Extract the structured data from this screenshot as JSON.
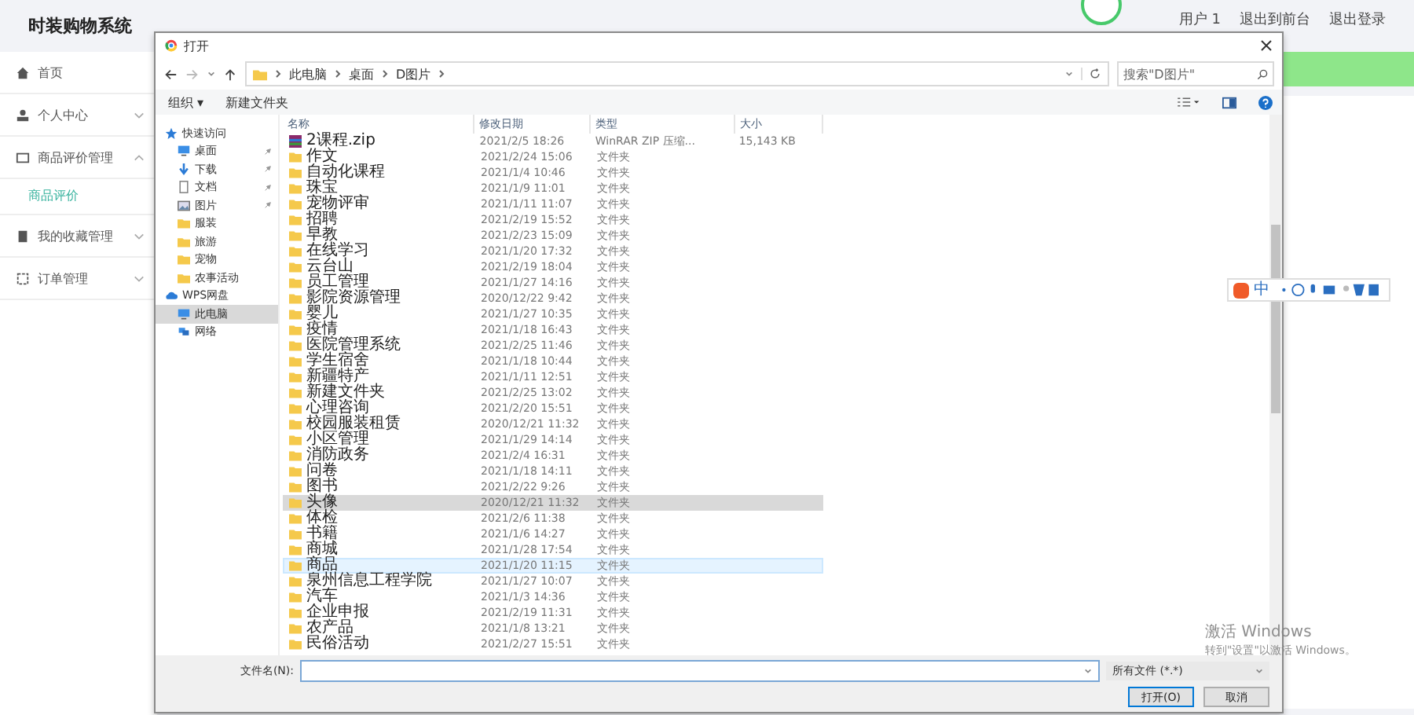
{
  "app": {
    "title": "时装购物系统",
    "user": "用户 1",
    "links": [
      "退出到前台",
      "退出登录"
    ]
  },
  "sidebar": [
    {
      "label": "首页"
    },
    {
      "label": "个人中心",
      "expanded": false
    },
    {
      "label": "商品评价管理",
      "expanded": true,
      "children": [
        {
          "label": "商品评价",
          "selected": true
        }
      ]
    },
    {
      "label": "我的收藏管理",
      "expanded": false
    },
    {
      "label": "订单管理",
      "expanded": false
    }
  ],
  "dialog": {
    "title": "打开",
    "path": [
      "此电脑",
      "桌面",
      "D图片"
    ],
    "search": {
      "placeholder": "搜索\"D图片\""
    },
    "toolbar": [
      "组织 ▾",
      "新建文件夹"
    ],
    "nav": [
      {
        "kind": "star",
        "label": "快速访问",
        "pinned": false,
        "selected": false
      },
      {
        "kind": "desktop",
        "label": "桌面",
        "pinned": true,
        "selected": false
      },
      {
        "kind": "download",
        "label": "下载",
        "pinned": true,
        "selected": false
      },
      {
        "kind": "doc",
        "label": "文档",
        "pinned": true,
        "selected": false
      },
      {
        "kind": "image",
        "label": "图片",
        "pinned": true,
        "selected": false
      },
      {
        "kind": "folder",
        "label": "服装",
        "pinned": false,
        "selected": false
      },
      {
        "kind": "folder",
        "label": "旅游",
        "pinned": false,
        "selected": false
      },
      {
        "kind": "folder",
        "label": "宠物",
        "pinned": false,
        "selected": false
      },
      {
        "kind": "folder",
        "label": "农事活动",
        "pinned": false,
        "selected": false
      },
      {
        "kind": "cloud",
        "label": "WPS网盘",
        "pinned": false,
        "selected": false
      },
      {
        "kind": "pc",
        "label": "此电脑",
        "pinned": false,
        "selected": true
      },
      {
        "kind": "network",
        "label": "网络",
        "pinned": false,
        "selected": false
      }
    ],
    "columns": [
      "名称",
      "修改日期",
      "类型",
      "大小"
    ],
    "files": [
      {
        "kind": "zip",
        "name": "2课程.zip",
        "date": "2021/2/5 18:26",
        "type": "WinRAR ZIP 压缩...",
        "size": "15,143 KB",
        "selected": false,
        "hovered": false
      },
      {
        "kind": "folder",
        "name": "作文",
        "date": "2021/2/24 15:06",
        "type": "文件夹",
        "selected": false,
        "hovered": false
      },
      {
        "kind": "folder",
        "name": "自动化课程",
        "date": "2021/1/4 10:46",
        "type": "文件夹",
        "selected": false,
        "hovered": false
      },
      {
        "kind": "folder",
        "name": "珠宝",
        "date": "2021/1/9 11:01",
        "type": "文件夹",
        "selected": false,
        "hovered": false
      },
      {
        "kind": "folder",
        "name": "宠物评审",
        "date": "2021/1/11 11:07",
        "type": "文件夹",
        "selected": false,
        "hovered": false
      },
      {
        "kind": "folder",
        "name": "招聘",
        "date": "2021/2/19 15:52",
        "type": "文件夹",
        "selected": false,
        "hovered": false
      },
      {
        "kind": "folder",
        "name": "早教",
        "date": "2021/2/23 15:09",
        "type": "文件夹",
        "selected": false,
        "hovered": false
      },
      {
        "kind": "folder",
        "name": "在线学习",
        "date": "2021/1/20 17:32",
        "type": "文件夹",
        "selected": false,
        "hovered": false
      },
      {
        "kind": "folder",
        "name": "云台山",
        "date": "2021/2/19 18:04",
        "type": "文件夹",
        "selected": false,
        "hovered": false
      },
      {
        "kind": "folder",
        "name": "员工管理",
        "date": "2021/1/27 14:16",
        "type": "文件夹",
        "selected": false,
        "hovered": false
      },
      {
        "kind": "folder",
        "name": "影院资源管理",
        "date": "2020/12/22 9:42",
        "type": "文件夹",
        "selected": false,
        "hovered": false
      },
      {
        "kind": "folder",
        "name": "婴儿",
        "date": "2021/1/27 10:35",
        "type": "文件夹",
        "selected": false,
        "hovered": false
      },
      {
        "kind": "folder",
        "name": "疫情",
        "date": "2021/1/18 16:43",
        "type": "文件夹",
        "selected": false,
        "hovered": false
      },
      {
        "kind": "folder",
        "name": "医院管理系统",
        "date": "2021/2/25 11:46",
        "type": "文件夹",
        "selected": false,
        "hovered": false
      },
      {
        "kind": "folder",
        "name": "学生宿舍",
        "date": "2021/1/18 10:44",
        "type": "文件夹",
        "selected": false,
        "hovered": false
      },
      {
        "kind": "folder",
        "name": "新疆特产",
        "date": "2021/1/11 12:51",
        "type": "文件夹",
        "selected": false,
        "hovered": false
      },
      {
        "kind": "folder",
        "name": "新建文件夹",
        "date": "2021/2/25 13:02",
        "type": "文件夹",
        "selected": false,
        "hovered": false
      },
      {
        "kind": "folder",
        "name": "心理咨询",
        "date": "2021/2/20 15:51",
        "type": "文件夹",
        "selected": false,
        "hovered": false
      },
      {
        "kind": "folder",
        "name": "校园服装租赁",
        "date": "2020/12/21 11:32",
        "type": "文件夹",
        "selected": false,
        "hovered": false
      },
      {
        "kind": "folder",
        "name": "小区管理",
        "date": "2021/1/29 14:14",
        "type": "文件夹",
        "selected": false,
        "hovered": false
      },
      {
        "kind": "folder",
        "name": "消防政务",
        "date": "2021/2/4 16:31",
        "type": "文件夹",
        "selected": false,
        "hovered": false
      },
      {
        "kind": "folder",
        "name": "问卷",
        "date": "2021/1/18 14:11",
        "type": "文件夹",
        "selected": false,
        "hovered": false
      },
      {
        "kind": "folder",
        "name": "图书",
        "date": "2021/2/22 9:26",
        "type": "文件夹",
        "selected": false,
        "hovered": false
      },
      {
        "kind": "folder",
        "name": "头像",
        "date": "2020/12/21 11:32",
        "type": "文件夹",
        "selected": true,
        "hovered": false
      },
      {
        "kind": "folder",
        "name": "体检",
        "date": "2021/2/6 11:38",
        "type": "文件夹",
        "selected": false,
        "hovered": false
      },
      {
        "kind": "folder",
        "name": "书籍",
        "date": "2021/1/6 14:27",
        "type": "文件夹",
        "selected": false,
        "hovered": false
      },
      {
        "kind": "folder",
        "name": "商城",
        "date": "2021/1/28 17:54",
        "type": "文件夹",
        "selected": false,
        "hovered": false
      },
      {
        "kind": "folder",
        "name": "商品",
        "date": "2021/1/20 11:15",
        "type": "文件夹",
        "selected": false,
        "hovered": true
      },
      {
        "kind": "folder",
        "name": "泉州信息工程学院",
        "date": "2021/1/27 10:07",
        "type": "文件夹",
        "selected": false,
        "hovered": false
      },
      {
        "kind": "folder",
        "name": "汽车",
        "date": "2021/1/3 14:36",
        "type": "文件夹",
        "selected": false,
        "hovered": false
      },
      {
        "kind": "folder",
        "name": "企业申报",
        "date": "2021/2/19 11:31",
        "type": "文件夹",
        "selected": false,
        "hovered": false
      },
      {
        "kind": "folder",
        "name": "农产品",
        "date": "2021/1/8 13:21",
        "type": "文件夹",
        "selected": false,
        "hovered": false
      },
      {
        "kind": "folder",
        "name": "民俗活动",
        "date": "2021/2/27 15:51",
        "type": "文件夹",
        "selected": false,
        "hovered": false
      }
    ],
    "filename_label": "文件名(N):",
    "filetype": "所有文件 (*.*)",
    "buttons": [
      "打开(O)",
      "取消"
    ]
  },
  "ime": {
    "mode": "中"
  },
  "activation": {
    "title": "激活 Windows",
    "hint": "转到\"设置\"以激活 Windows。"
  }
}
